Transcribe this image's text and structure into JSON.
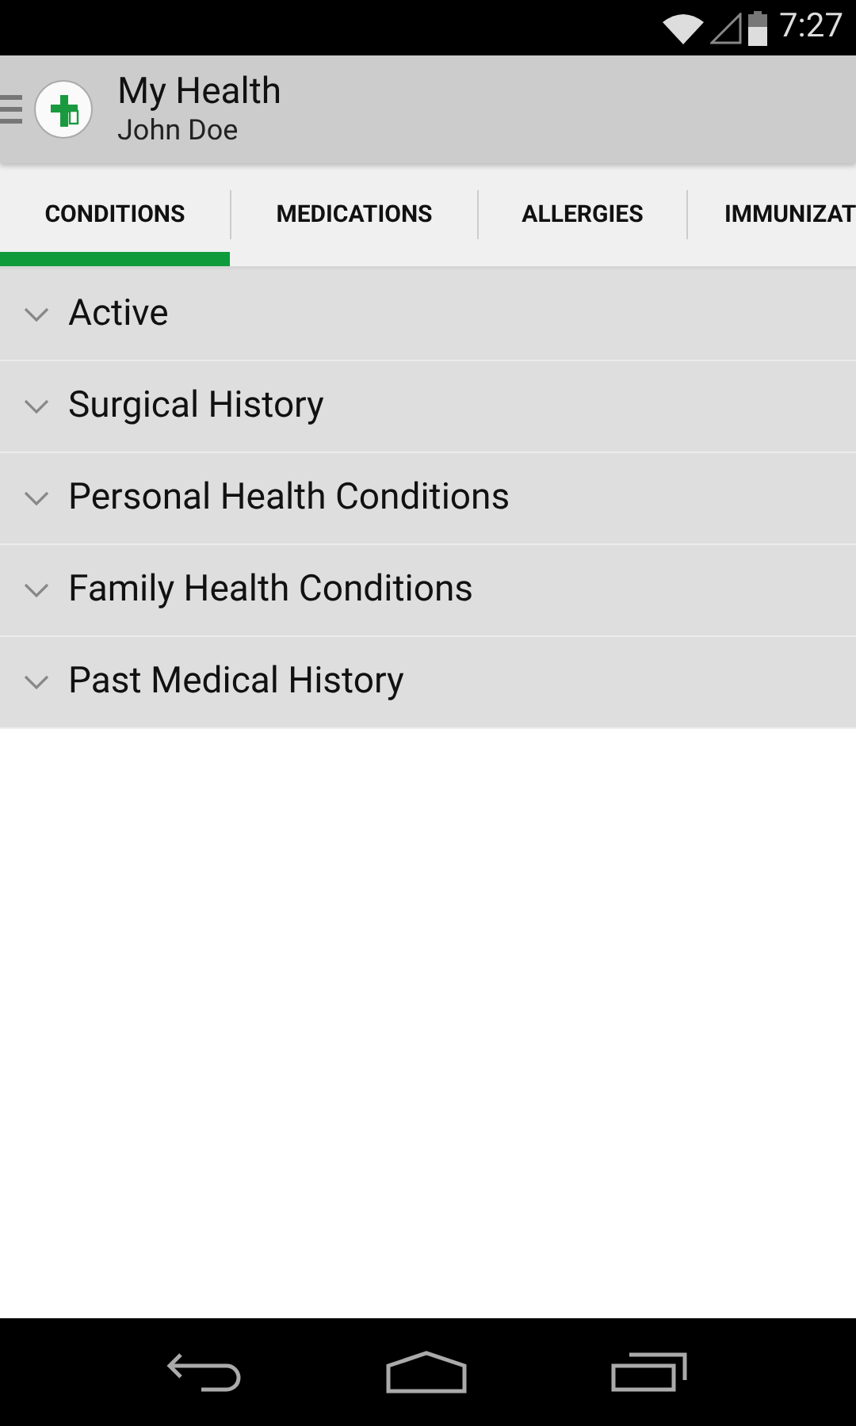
{
  "status_bar": {
    "time": "7:27"
  },
  "app_bar": {
    "title": "My Health",
    "subtitle": "John Doe"
  },
  "tabs": [
    {
      "label": "CONDITIONS",
      "selected": true
    },
    {
      "label": "MEDICATIONS",
      "selected": false
    },
    {
      "label": "ALLERGIES",
      "selected": false
    },
    {
      "label": "IMMUNIZAT",
      "selected": false
    }
  ],
  "sections": [
    {
      "label": "Active",
      "expanded": false
    },
    {
      "label": "Surgical History",
      "expanded": false
    },
    {
      "label": "Personal Health Conditions",
      "expanded": false
    },
    {
      "label": "Family Health Conditions",
      "expanded": false
    },
    {
      "label": "Past Medical History",
      "expanded": false
    }
  ]
}
